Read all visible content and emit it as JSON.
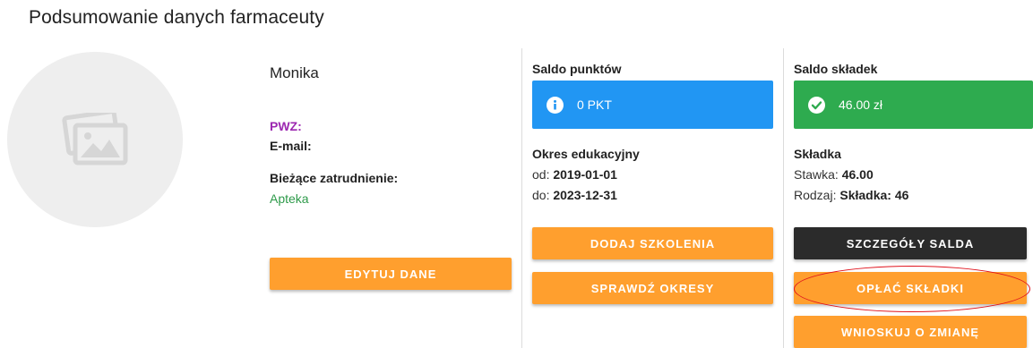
{
  "page": {
    "title": "Podsumowanie danych farmaceuty"
  },
  "profile": {
    "name": "Monika",
    "pwz_label": "PWZ:",
    "email_label": "E-mail:",
    "employment_label": "Bieżące zatrudnienie:",
    "employment_value": "Apteka",
    "edit_button": "EDYTUJ DANE",
    "avatar_icon": "image-placeholder-icon"
  },
  "points": {
    "title": "Saldo punktów",
    "value": "0 PKT",
    "icon": "info-icon",
    "color": "#2196f3",
    "period_title": "Okres edukacyjny",
    "from_label": "od:",
    "from_value": "2019-01-01",
    "to_label": "do:",
    "to_value": "2023-12-31",
    "add_button": "DODAJ SZKOLENIA",
    "check_button": "SPRAWDŹ OKRESY"
  },
  "fees": {
    "title": "Saldo składek",
    "value": "46.00 zł",
    "icon": "check-circle-icon",
    "color": "#2eab4f",
    "section_title": "Składka",
    "rate_label": "Stawka:",
    "rate_value": "46.00",
    "type_label": "Rodzaj:",
    "type_value": "Składka: 46",
    "details_button": "SZCZEGÓŁY SALDA",
    "pay_button": "OPŁAĆ SKŁADKI",
    "request_button": "WNIOSKUJ O ZMIANĘ"
  },
  "colors": {
    "accent": "#ff9f2e",
    "pwz": "#9c27b0",
    "employment": "#2e9a4a",
    "highlight": "#e0141e"
  }
}
